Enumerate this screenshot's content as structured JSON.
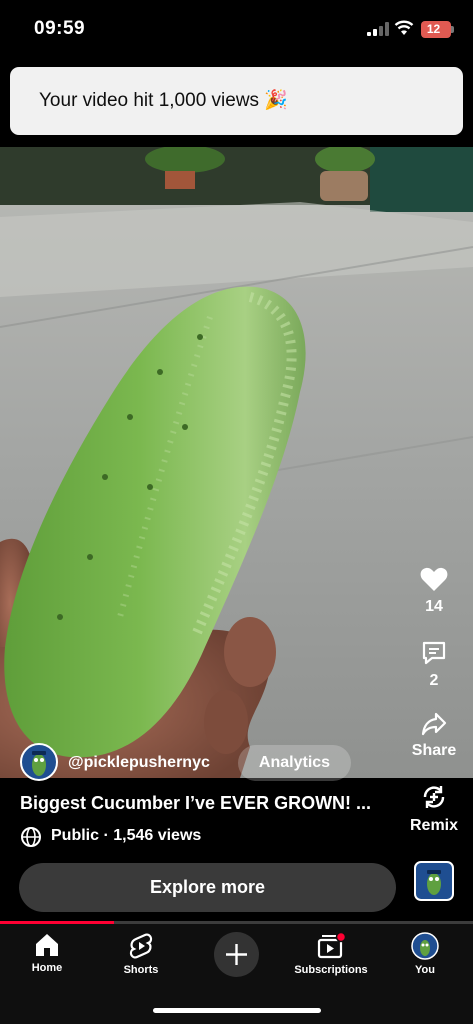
{
  "status_bar": {
    "time": "09:59",
    "battery": "12"
  },
  "toast": {
    "message": "Your video hit 1,000 views 🎉"
  },
  "actions": {
    "like_count": "14",
    "comment_count": "2",
    "share_label": "Share",
    "remix_label": "Remix"
  },
  "channel": {
    "handle": "@picklepushernyc",
    "analytics_label": "Analytics"
  },
  "video": {
    "title": "Biggest Cucumber I’ve EVER GROWN! ...",
    "visibility": "Public · 1,546 views",
    "progress": 0.24
  },
  "explore_label": "Explore more",
  "nav": {
    "home": "Home",
    "shorts": "Shorts",
    "subscriptions": "Subscriptions",
    "you": "You"
  },
  "colors": {
    "accent": "#ff0033",
    "battery": "#e05a52"
  }
}
